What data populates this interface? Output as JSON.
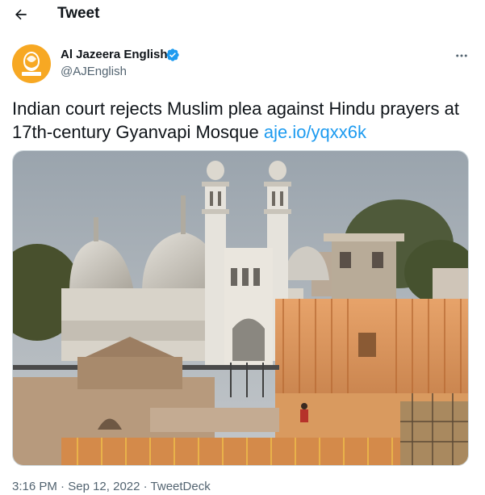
{
  "header": {
    "title": "Tweet"
  },
  "author": {
    "name": "Al Jazeera English",
    "handle": "@AJEnglish",
    "avatar_text": "الجزيرة",
    "avatar_subtext": "ALJAZEERA",
    "verified": true
  },
  "tweet": {
    "text": "Indian court rejects Muslim plea against Hindu prayers at 17th-century Gyanvapi Mosque ",
    "link": "aje.io/yqxx6k"
  },
  "meta": {
    "time": "3:16 PM",
    "separator": " · ",
    "date": "Sep 12, 2022",
    "source": "TweetDeck"
  },
  "colors": {
    "accent": "#1d9bf0",
    "secondary_text": "#536471",
    "avatar_bg": "#f7a823"
  },
  "icons": [
    "back-arrow-icon",
    "verified-badge-icon",
    "more-options-icon"
  ]
}
